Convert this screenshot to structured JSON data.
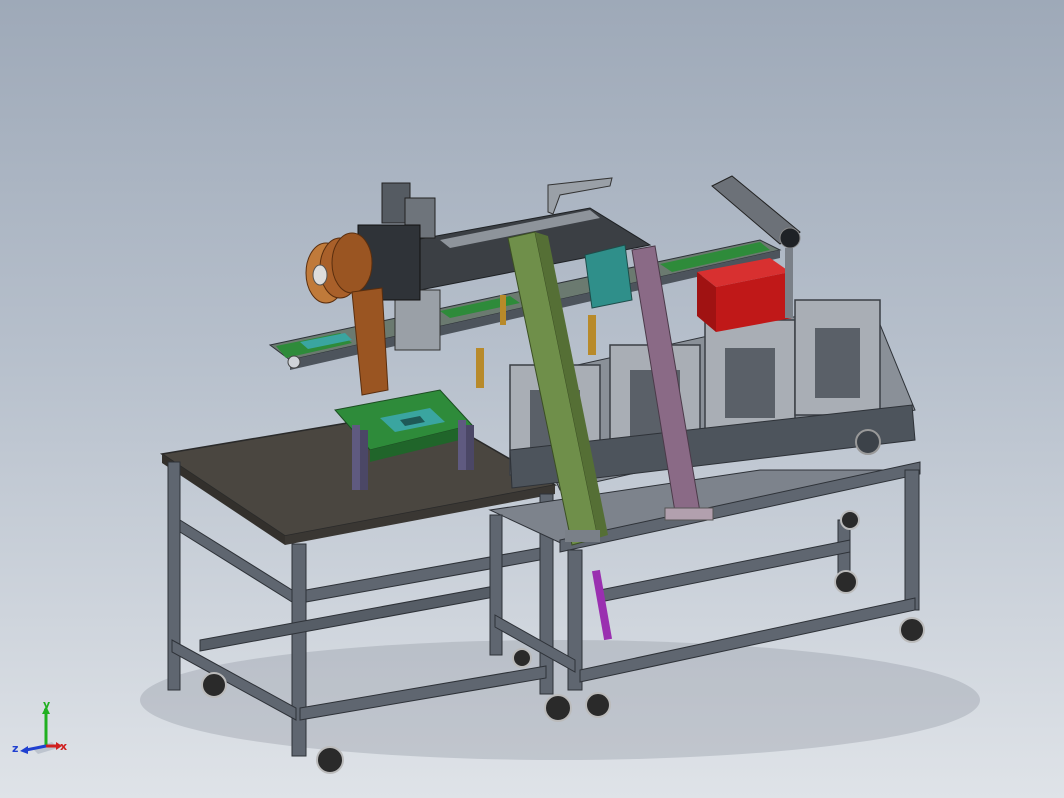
{
  "triad": {
    "x_label": "x",
    "y_label": "y",
    "z_label": "z"
  },
  "colors": {
    "background_top": "#9ea9b8",
    "background_bottom": "#dfe3e8",
    "frame": "#5f6670",
    "tabletop": "#4a4640",
    "conveyor_green": "#2e8b3a",
    "pcb_teal": "#3aa5a0",
    "red_box": "#c01818",
    "olive_column": "#6f8f4a",
    "mauve_column": "#8a6a86",
    "copper_roll": "#9a5522",
    "axis_x": "#d02020",
    "axis_y": "#20b020",
    "axis_z": "#2040d0"
  }
}
